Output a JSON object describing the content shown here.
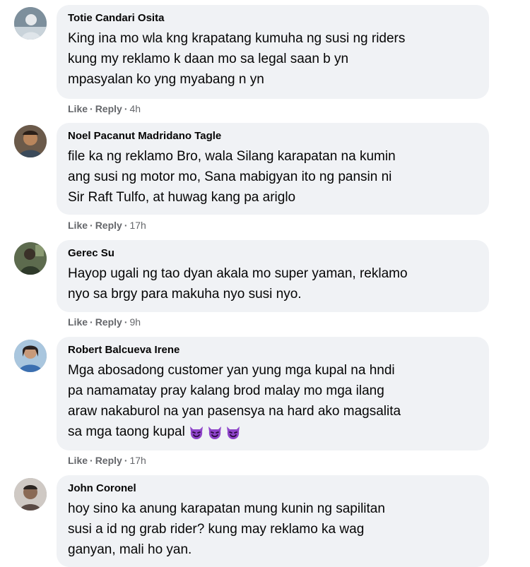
{
  "comments": [
    {
      "author": "Totie Candari Osita",
      "lines": [
        "King ina mo wla kng krapatang kumuha ng susi ng riders",
        "kung my reklamo k daan mo sa legal saan b yn",
        "mpasyalan ko yng myabang n yn"
      ],
      "like_label": "Like",
      "reply_label": "Reply",
      "time": "4h",
      "avatar_icon": "profile-photo"
    },
    {
      "author": "Noel Pacanut Madridano Tagle",
      "lines": [
        "file ka ng reklamo Bro, wala Silang karapatan na kumin",
        "ang susi ng motor mo, Sana mabigyan ito ng pansin ni",
        "Sir Raft Tulfo, at huwag kang pa ariglo"
      ],
      "like_label": "Like",
      "reply_label": "Reply",
      "time": "17h",
      "avatar_icon": "profile-photo"
    },
    {
      "author": "Gerec Su",
      "lines": [
        "Hayop ugali ng tao dyan akala mo super yaman, reklamo",
        "nyo sa brgy para makuha nyo susi nyo."
      ],
      "like_label": "Like",
      "reply_label": "Reply",
      "time": "9h",
      "avatar_icon": "profile-photo"
    },
    {
      "author": "Robert Balcueva Irene",
      "lines": [
        "Mga abosadong customer yan yung mga kupal na hndi",
        "pa namamatay pray kalang brod malay mo mga ilang",
        "araw nakaburol na yan pasensya na hard ako magsalita",
        "sa mga taong kupal"
      ],
      "emoji_icon": "smiling-imp-emoji",
      "emoji_count": 3,
      "like_label": "Like",
      "reply_label": "Reply",
      "time": "17h",
      "avatar_icon": "profile-photo"
    },
    {
      "author": "John Coronel",
      "lines": [
        "hoy sino ka anung karapatan mung kunin ng sapilitan",
        "susi a id ng grab rider? kung may reklamo ka wag",
        "ganyan, mali ho yan."
      ],
      "avatar_icon": "profile-photo"
    }
  ],
  "colors": {
    "bubble": "#f0f2f5",
    "text": "#050505",
    "meta": "#65676b",
    "emoji": "#8e44c9"
  }
}
